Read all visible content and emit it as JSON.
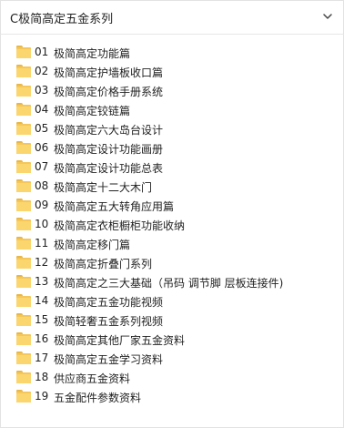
{
  "header": {
    "title": "C极简高定五金系列",
    "chevron_icon": "chevron-down-icon"
  },
  "folder_icon": "folder-icon",
  "colors": {
    "folder": "#f5c75a",
    "text": "#222222",
    "border": "#e3e3e3"
  },
  "items": [
    {
      "num": "01",
      "label": "极简高定功能篇"
    },
    {
      "num": "02",
      "label": "极简高定护墙板收口篇"
    },
    {
      "num": "03",
      "label": "极简高定价格手册系统"
    },
    {
      "num": "04",
      "label": "极简高定铰链篇"
    },
    {
      "num": "05",
      "label": "极简高定六大岛台设计"
    },
    {
      "num": "06",
      "label": "极简高定设计功能画册"
    },
    {
      "num": "07",
      "label": "极简高定设计功能总表"
    },
    {
      "num": "08",
      "label": "极简高定十二大木门"
    },
    {
      "num": "09",
      "label": "极简高定五大转角应用篇"
    },
    {
      "num": "10",
      "label": "极简高定衣柜橱柜功能收纳"
    },
    {
      "num": "11",
      "label": "极简高定移门篇"
    },
    {
      "num": "12",
      "label": "极简高定折叠门系列"
    },
    {
      "num": "13",
      "label": "极简高定之三大基础（吊码 调节脚 层板连接件)"
    },
    {
      "num": "14",
      "label": "极简高定五金功能视频"
    },
    {
      "num": "15",
      "label": "极简轻奢五金系列视频"
    },
    {
      "num": "16",
      "label": "极简高定其他厂家五金资料"
    },
    {
      "num": "17",
      "label": "极简高定五金学习资料"
    },
    {
      "num": "18",
      "label": "供应商五金资料"
    },
    {
      "num": "19",
      "label": "五金配件参数资料"
    }
  ]
}
